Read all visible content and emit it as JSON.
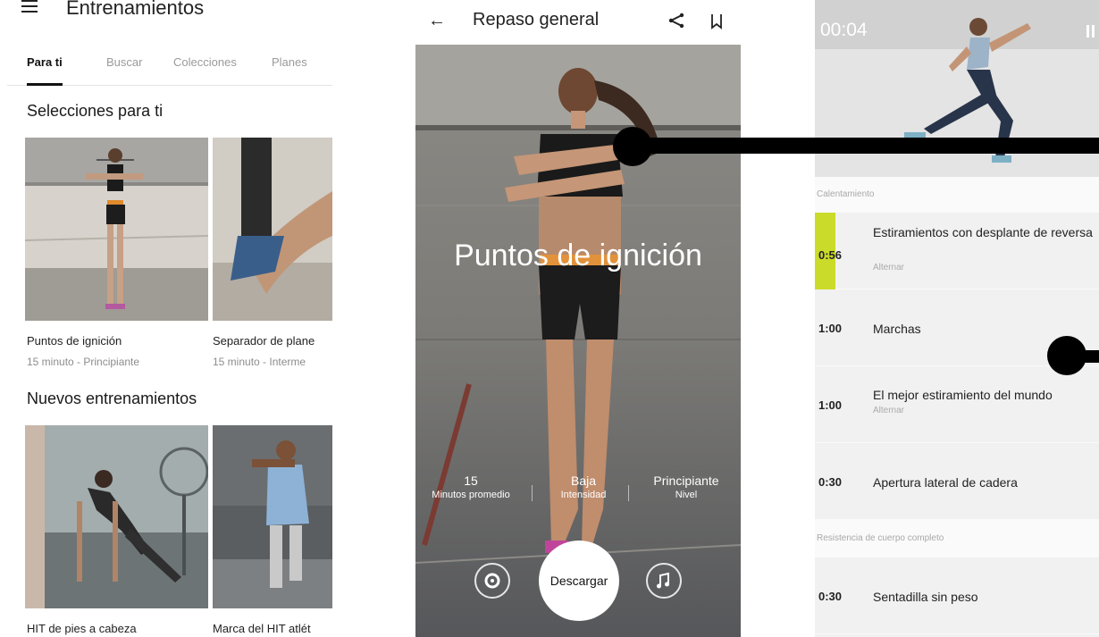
{
  "screen1": {
    "app_title": "Entrenamientos",
    "tabs": [
      {
        "label": "Para ti",
        "active": true
      },
      {
        "label": "Buscar",
        "active": false
      },
      {
        "label": "Colecciones",
        "active": false
      },
      {
        "label": "Planes",
        "active": false
      }
    ],
    "picks_title": "Selecciones para ti",
    "picks": [
      {
        "title": "Puntos de ignición",
        "subtitle": "15 minuto - Principiante"
      },
      {
        "title": "Separador de plane",
        "subtitle": "15 minuto - Interme"
      }
    ],
    "new_title": "Nuevos entrenamientos",
    "new_items": [
      {
        "title": "HIT de pies a cabeza"
      },
      {
        "title": "Marca del HIT atlét"
      }
    ]
  },
  "screen2": {
    "header_title": "Repaso general",
    "workout_title": "Puntos de ignición",
    "stats": [
      {
        "value": "15",
        "label": "Minutos promedio"
      },
      {
        "value": "Baja",
        "label": "Intensidad"
      },
      {
        "value": "Principiante",
        "label": "Nivel"
      }
    ],
    "download_label": "Descargar"
  },
  "screen3": {
    "timer": "00:04",
    "sections": [
      {
        "title": "Calentamiento",
        "items": [
          {
            "time": "0:56",
            "name": "Estiramientos con desplante de reversa",
            "note": "Alternar",
            "active": true
          },
          {
            "time": "1:00",
            "name": "Marchas",
            "note": "",
            "active": false
          },
          {
            "time": "1:00",
            "name": "El mejor estiramiento del mundo",
            "note": "Alternar",
            "active": false
          },
          {
            "time": "0:30",
            "name": "Apertura lateral de cadera",
            "note": "",
            "active": false
          }
        ]
      },
      {
        "title": "Resistencia de cuerpo completo",
        "items": [
          {
            "time": "0:30",
            "name": "Sentadilla sin peso",
            "note": "",
            "active": false
          }
        ]
      }
    ]
  },
  "colors": {
    "accent_active": "#cbdb2a",
    "tab_active": "#111111",
    "text_secondary": "#8d8d8d"
  },
  "icons": [
    "menu-icon",
    "back-arrow-icon",
    "share-icon",
    "bookmark-icon",
    "settings-icon",
    "music-icon",
    "pause-icon"
  ]
}
